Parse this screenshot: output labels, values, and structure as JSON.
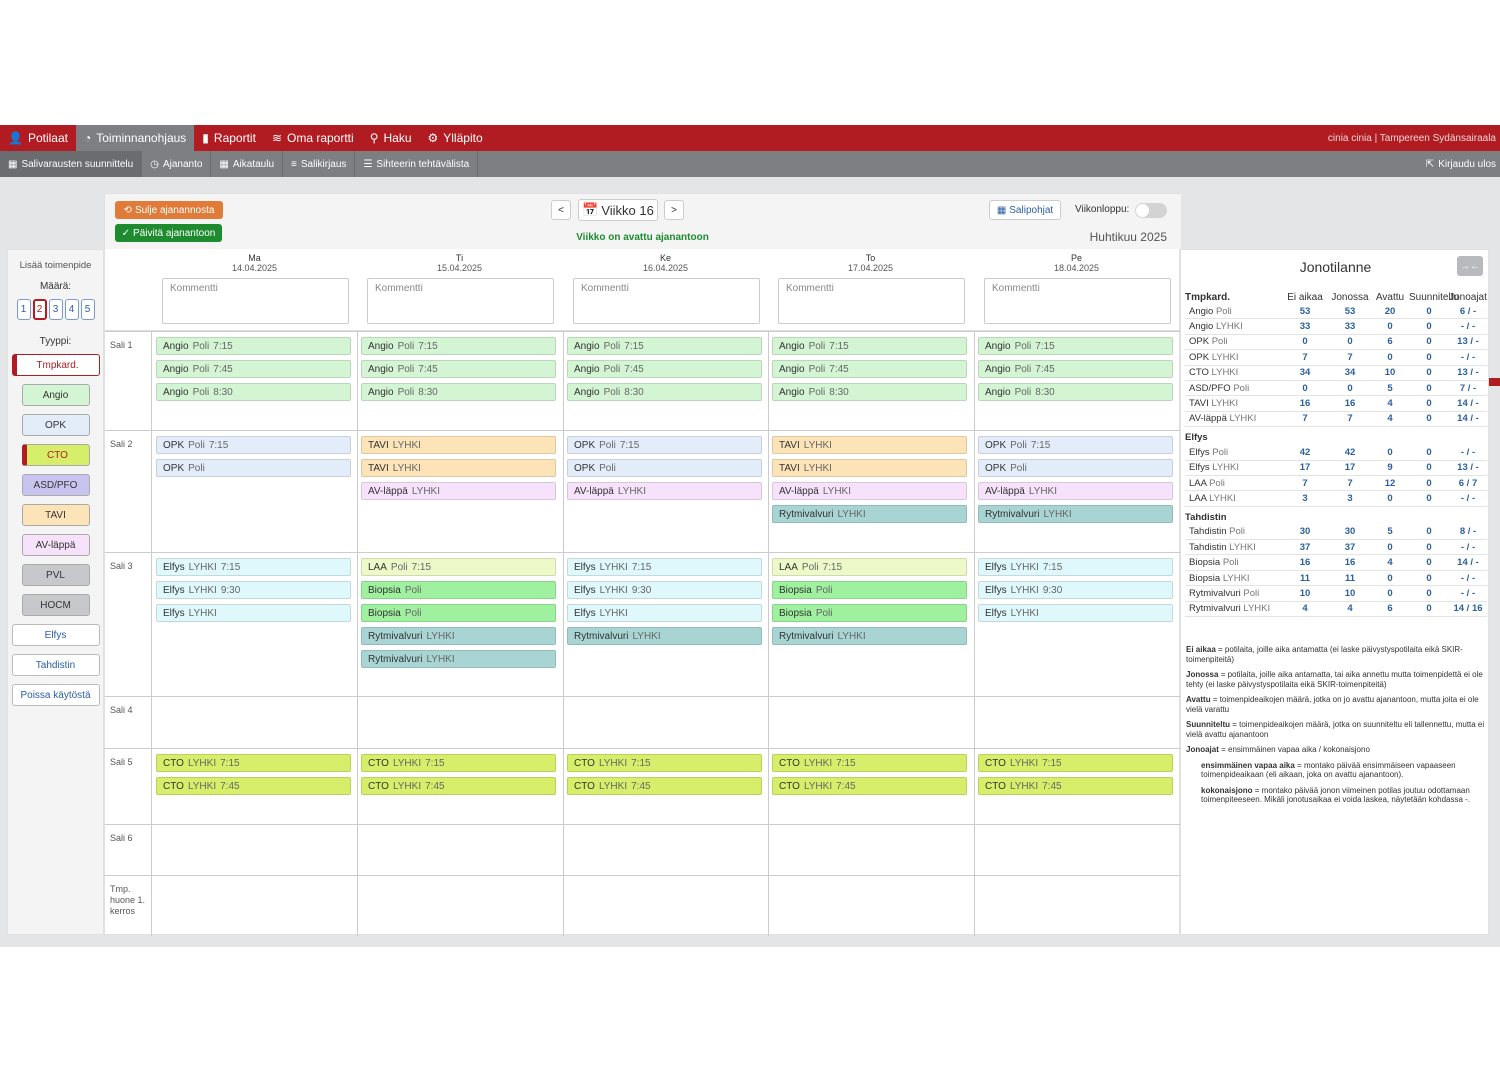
{
  "nav1": {
    "items": [
      {
        "label": "Potilaat",
        "icon": "user-icon"
      },
      {
        "label": "Toiminnanohjaus",
        "icon": "dashboard-icon",
        "active": true
      },
      {
        "label": "Raportit",
        "icon": "bar-chart-icon"
      },
      {
        "label": "Oma raportti",
        "icon": "line-chart-icon"
      },
      {
        "label": "Haku",
        "icon": "search-icon"
      },
      {
        "label": "Ylläpito",
        "icon": "gear-icon"
      }
    ],
    "user": "cinia cinia | Tampereen Sydänsairaala"
  },
  "nav2": {
    "items": [
      {
        "label": "Salivarausten suunnittelu",
        "icon": "table-icon",
        "active": true
      },
      {
        "label": "Ajananto",
        "icon": "clock-icon"
      },
      {
        "label": "Aikataulu",
        "icon": "calendar-icon"
      },
      {
        "label": "Salikirjaus",
        "icon": "list-icon"
      },
      {
        "label": "Sihteerin tehtävälista",
        "icon": "tasks-icon"
      }
    ],
    "logout": "Kirjaudu ulos"
  },
  "left": {
    "title": "Lisää toimenpide",
    "amount_label": "Määrä:",
    "amounts": [
      "1",
      "2",
      "3",
      "4",
      "5"
    ],
    "selected_amount": "2",
    "type_label": "Tyyppi:",
    "types": [
      {
        "label": "Tmpkard.",
        "bg": "#ffffff",
        "color": "#b01c22"
      },
      {
        "label": "Angio",
        "bg": "#d4f5d4",
        "color": "#333"
      },
      {
        "label": "OPK",
        "bg": "#e3edfa",
        "color": "#333"
      },
      {
        "label": "CTO",
        "bg": "#d6ee6a",
        "color": "#b01c22"
      },
      {
        "label": "ASD/PFO",
        "bg": "#c9c3f0",
        "color": "#333"
      },
      {
        "label": "TAVI",
        "bg": "#fde4b8",
        "color": "#333"
      },
      {
        "label": "AV-läppä",
        "bg": "#f6e2fa",
        "color": "#333"
      },
      {
        "label": "PVL",
        "bg": "#c6c8cb",
        "color": "#333"
      },
      {
        "label": "HOCM",
        "bg": "#c6c8cb",
        "color": "#333"
      },
      {
        "label": "Elfys",
        "bg": "#ffffff",
        "color": "#2a5fa0"
      },
      {
        "label": "Tahdistin",
        "bg": "#ffffff",
        "color": "#2a5fa0"
      },
      {
        "label": "Poissa käytöstä",
        "bg": "#ffffff",
        "color": "#2a5fa0"
      }
    ]
  },
  "toolbar": {
    "close": "Sulje ajanannosta",
    "update": "Päivitä ajanantoon",
    "prev": "<",
    "week": "Viikko 16",
    "next": ">",
    "week_open": "Viikko on avattu ajanantoon",
    "templates": "Salipohjat",
    "weekend": "Viikonloppu:",
    "month": "Huhtikuu 2025"
  },
  "days": [
    {
      "name": "Ma",
      "date": "14.04.2025"
    },
    {
      "name": "Ti",
      "date": "15.04.2025"
    },
    {
      "name": "Ke",
      "date": "16.04.2025"
    },
    {
      "name": "To",
      "date": "17.04.2025"
    },
    {
      "name": "Pe",
      "date": "18.04.2025"
    }
  ],
  "comment_placeholder": "Kommentti",
  "rooms": [
    "Sali 1",
    "Sali 2",
    "Sali 3",
    "Sali 4",
    "Sali 5",
    "Sali 6",
    "Tmp. huone 1. kerros"
  ],
  "colors": {
    "angio": "#d4f5d4",
    "opk": "#e3edfa",
    "tavi": "#fde4b8",
    "avl": "#f6e2fa",
    "rytm": "#a8d5d3",
    "elfys": "#dff8fb",
    "laa": "#edf9c8",
    "biopsia": "#9ff09f",
    "cto": "#d6ee6a",
    "brand": "#b01c22"
  },
  "events": {
    "r0": [
      [
        {
          "n": "Angio",
          "s": "Poli",
          "t": "7:15",
          "c": "angio"
        },
        {
          "n": "Angio",
          "s": "Poli",
          "t": "7:45",
          "c": "angio"
        },
        {
          "n": "Angio",
          "s": "Poli",
          "t": "8:30",
          "c": "angio"
        }
      ],
      [
        {
          "n": "Angio",
          "s": "Poli",
          "t": "7:15",
          "c": "angio"
        },
        {
          "n": "Angio",
          "s": "Poli",
          "t": "7:45",
          "c": "angio"
        },
        {
          "n": "Angio",
          "s": "Poli",
          "t": "8:30",
          "c": "angio"
        }
      ],
      [
        {
          "n": "Angio",
          "s": "Poli",
          "t": "7:15",
          "c": "angio"
        },
        {
          "n": "Angio",
          "s": "Poli",
          "t": "7:45",
          "c": "angio"
        },
        {
          "n": "Angio",
          "s": "Poli",
          "t": "8:30",
          "c": "angio"
        }
      ],
      [
        {
          "n": "Angio",
          "s": "Poli",
          "t": "7:15",
          "c": "angio"
        },
        {
          "n": "Angio",
          "s": "Poli",
          "t": "7:45",
          "c": "angio"
        },
        {
          "n": "Angio",
          "s": "Poli",
          "t": "8:30",
          "c": "angio"
        }
      ],
      [
        {
          "n": "Angio",
          "s": "Poli",
          "t": "7:15",
          "c": "angio"
        },
        {
          "n": "Angio",
          "s": "Poli",
          "t": "7:45",
          "c": "angio"
        },
        {
          "n": "Angio",
          "s": "Poli",
          "t": "8:30",
          "c": "angio"
        }
      ]
    ],
    "r1": [
      [
        {
          "n": "OPK",
          "s": "Poli",
          "t": "7:15",
          "c": "opk"
        },
        {
          "n": "OPK",
          "s": "Poli",
          "t": "",
          "c": "opk"
        }
      ],
      [
        {
          "n": "TAVI",
          "s": "LYHKI",
          "t": "",
          "c": "tavi"
        },
        {
          "n": "TAVI",
          "s": "LYHKI",
          "t": "",
          "c": "tavi"
        },
        {
          "n": "AV-läppä",
          "s": "LYHKI",
          "t": "",
          "c": "avl"
        }
      ],
      [
        {
          "n": "OPK",
          "s": "Poli",
          "t": "7:15",
          "c": "opk"
        },
        {
          "n": "OPK",
          "s": "Poli",
          "t": "",
          "c": "opk"
        },
        {
          "n": "AV-läppä",
          "s": "LYHKI",
          "t": "",
          "c": "avl"
        }
      ],
      [
        {
          "n": "TAVI",
          "s": "LYHKI",
          "t": "",
          "c": "tavi"
        },
        {
          "n": "TAVI",
          "s": "LYHKI",
          "t": "",
          "c": "tavi"
        },
        {
          "n": "AV-läppä",
          "s": "LYHKI",
          "t": "",
          "c": "avl"
        },
        {
          "n": "Rytmivalvuri",
          "s": "LYHKI",
          "t": "",
          "c": "rytm"
        }
      ],
      [
        {
          "n": "OPK",
          "s": "Poli",
          "t": "7:15",
          "c": "opk"
        },
        {
          "n": "OPK",
          "s": "Poli",
          "t": "",
          "c": "opk"
        },
        {
          "n": "AV-läppä",
          "s": "LYHKI",
          "t": "",
          "c": "avl"
        },
        {
          "n": "Rytmivalvuri",
          "s": "LYHKI",
          "t": "",
          "c": "rytm"
        }
      ]
    ],
    "r2": [
      [
        {
          "n": "Elfys",
          "s": "LYHKI",
          "t": "7:15",
          "c": "elfys"
        },
        {
          "n": "Elfys",
          "s": "LYHKI",
          "t": "9:30",
          "c": "elfys"
        },
        {
          "n": "Elfys",
          "s": "LYHKI",
          "t": "",
          "c": "elfys"
        }
      ],
      [
        {
          "n": "LAA",
          "s": "Poli",
          "t": "7:15",
          "c": "laa"
        },
        {
          "n": "Biopsia",
          "s": "Poli",
          "t": "",
          "c": "biopsia"
        },
        {
          "n": "Biopsia",
          "s": "Poli",
          "t": "",
          "c": "biopsia"
        },
        {
          "n": "Rytmivalvuri",
          "s": "LYHKI",
          "t": "",
          "c": "rytm"
        },
        {
          "n": "Rytmivalvuri",
          "s": "LYHKI",
          "t": "",
          "c": "rytm"
        }
      ],
      [
        {
          "n": "Elfys",
          "s": "LYHKI",
          "t": "7:15",
          "c": "elfys"
        },
        {
          "n": "Elfys",
          "s": "LYHKI",
          "t": "9:30",
          "c": "elfys"
        },
        {
          "n": "Elfys",
          "s": "LYHKI",
          "t": "",
          "c": "elfys"
        },
        {
          "n": "Rytmivalvuri",
          "s": "LYHKI",
          "t": "",
          "c": "rytm"
        }
      ],
      [
        {
          "n": "LAA",
          "s": "Poli",
          "t": "7:15",
          "c": "laa"
        },
        {
          "n": "Biopsia",
          "s": "Poli",
          "t": "",
          "c": "biopsia"
        },
        {
          "n": "Biopsia",
          "s": "Poli",
          "t": "",
          "c": "biopsia"
        },
        {
          "n": "Rytmivalvuri",
          "s": "LYHKI",
          "t": "",
          "c": "rytm"
        }
      ],
      [
        {
          "n": "Elfys",
          "s": "LYHKI",
          "t": "7:15",
          "c": "elfys"
        },
        {
          "n": "Elfys",
          "s": "LYHKI",
          "t": "9:30",
          "c": "elfys"
        },
        {
          "n": "Elfys",
          "s": "LYHKI",
          "t": "",
          "c": "elfys"
        }
      ]
    ],
    "r4": [
      [
        {
          "n": "CTO",
          "s": "LYHKI",
          "t": "7:15",
          "c": "cto"
        },
        {
          "n": "CTO",
          "s": "LYHKI",
          "t": "7:45",
          "c": "cto"
        }
      ],
      [
        {
          "n": "CTO",
          "s": "LYHKI",
          "t": "7:15",
          "c": "cto"
        },
        {
          "n": "CTO",
          "s": "LYHKI",
          "t": "7:45",
          "c": "cto"
        }
      ],
      [
        {
          "n": "CTO",
          "s": "LYHKI",
          "t": "7:15",
          "c": "cto"
        },
        {
          "n": "CTO",
          "s": "LYHKI",
          "t": "7:45",
          "c": "cto"
        }
      ],
      [
        {
          "n": "CTO",
          "s": "LYHKI",
          "t": "7:15",
          "c": "cto"
        },
        {
          "n": "CTO",
          "s": "LYHKI",
          "t": "7:45",
          "c": "cto"
        }
      ],
      [
        {
          "n": "CTO",
          "s": "LYHKI",
          "t": "7:15",
          "c": "cto"
        },
        {
          "n": "CTO",
          "s": "LYHKI",
          "t": "7:45",
          "c": "cto"
        }
      ]
    ]
  },
  "queue": {
    "title": "Jonotilanne",
    "headers": [
      "Tmpkard.",
      "Ei aikaa",
      "Jonossa",
      "Avattu",
      "Suunniteltu",
      "Jonoajat"
    ],
    "groups": [
      {
        "name": "",
        "rows": [
          [
            "Angio",
            "Poli",
            "53",
            "53",
            "20",
            "0",
            "6 / -"
          ],
          [
            "Angio",
            "LYHKI",
            "33",
            "33",
            "0",
            "0",
            "- / -"
          ],
          [
            "OPK",
            "Poli",
            "0",
            "0",
            "6",
            "0",
            "13 / -"
          ],
          [
            "OPK",
            "LYHKI",
            "7",
            "7",
            "0",
            "0",
            "- / -"
          ],
          [
            "CTO",
            "LYHKI",
            "34",
            "34",
            "10",
            "0",
            "13 / -"
          ],
          [
            "ASD/PFO",
            "Poli",
            "0",
            "0",
            "5",
            "0",
            "7 / -"
          ],
          [
            "TAVI",
            "LYHKI",
            "16",
            "16",
            "4",
            "0",
            "14 / -"
          ],
          [
            "AV-läppä",
            "LYHKI",
            "7",
            "7",
            "4",
            "0",
            "14 / -"
          ]
        ]
      },
      {
        "name": "Elfys",
        "rows": [
          [
            "Elfys",
            "Poli",
            "42",
            "42",
            "0",
            "0",
            "- / -"
          ],
          [
            "Elfys",
            "LYHKI",
            "17",
            "17",
            "9",
            "0",
            "13 / -"
          ],
          [
            "LAA",
            "Poli",
            "7",
            "7",
            "12",
            "0",
            "6 / 7"
          ],
          [
            "LAA",
            "LYHKI",
            "3",
            "3",
            "0",
            "0",
            "- / -"
          ]
        ]
      },
      {
        "name": "Tahdistin",
        "rows": [
          [
            "Tahdistin",
            "Poli",
            "30",
            "30",
            "5",
            "0",
            "8 / -"
          ],
          [
            "Tahdistin",
            "LYHKI",
            "37",
            "37",
            "0",
            "0",
            "- / -"
          ],
          [
            "Biopsia",
            "Poli",
            "16",
            "16",
            "4",
            "0",
            "14 / -"
          ],
          [
            "Biopsia",
            "LYHKI",
            "11",
            "11",
            "0",
            "0",
            "- / -"
          ],
          [
            "Rytmivalvuri",
            "Poli",
            "10",
            "10",
            "0",
            "0",
            "- / -"
          ],
          [
            "Rytmivalvuri",
            "LYHKI",
            "4",
            "4",
            "6",
            "0",
            "14 / 16"
          ]
        ]
      }
    ],
    "legend": [
      {
        "k": "Ei aikaa",
        "t": " = potilaita, joille aika antamatta (ei laske päivystyspotilaita eikä SKIR-toimenpiteitä)",
        "ind": false
      },
      {
        "k": "Jonossa",
        "t": " = potilaita, joille aika antamatta, tai aika annettu mutta toimenpidettä ei ole tehty (ei laske päivystyspotilaita eikä SKIR-toimenpiteitä)",
        "ind": false
      },
      {
        "k": "Avattu",
        "t": " = toimenpideaikojen määrä, jotka on jo avattu ajanantoon, mutta joita ei ole vielä varattu",
        "ind": false
      },
      {
        "k": "Suunniteltu",
        "t": " = toimenpideaikojen määrä, jotka on suunniteltu eli tallennettu, mutta ei vielä avattu ajanantoon",
        "ind": false
      },
      {
        "k": "Jonoajat",
        "t": " = ensimmäinen vapaa aika / kokonaisjono",
        "ind": false
      },
      {
        "k": "ensimmäinen vapaa aika",
        "t": " = montako päivää ensimmäiseen vapaaseen toimenpideaikaan (eli aikaan, joka on avattu ajanantoon).",
        "ind": true
      },
      {
        "k": "kokonaisjono",
        "t": " = montako päivää jonon viimeinen potilas joutuu odottamaan toimenpiteeseen. Mikäli jonotusaikaa ei voida laskea, näytetään kohdassa -.",
        "ind": true
      }
    ]
  }
}
